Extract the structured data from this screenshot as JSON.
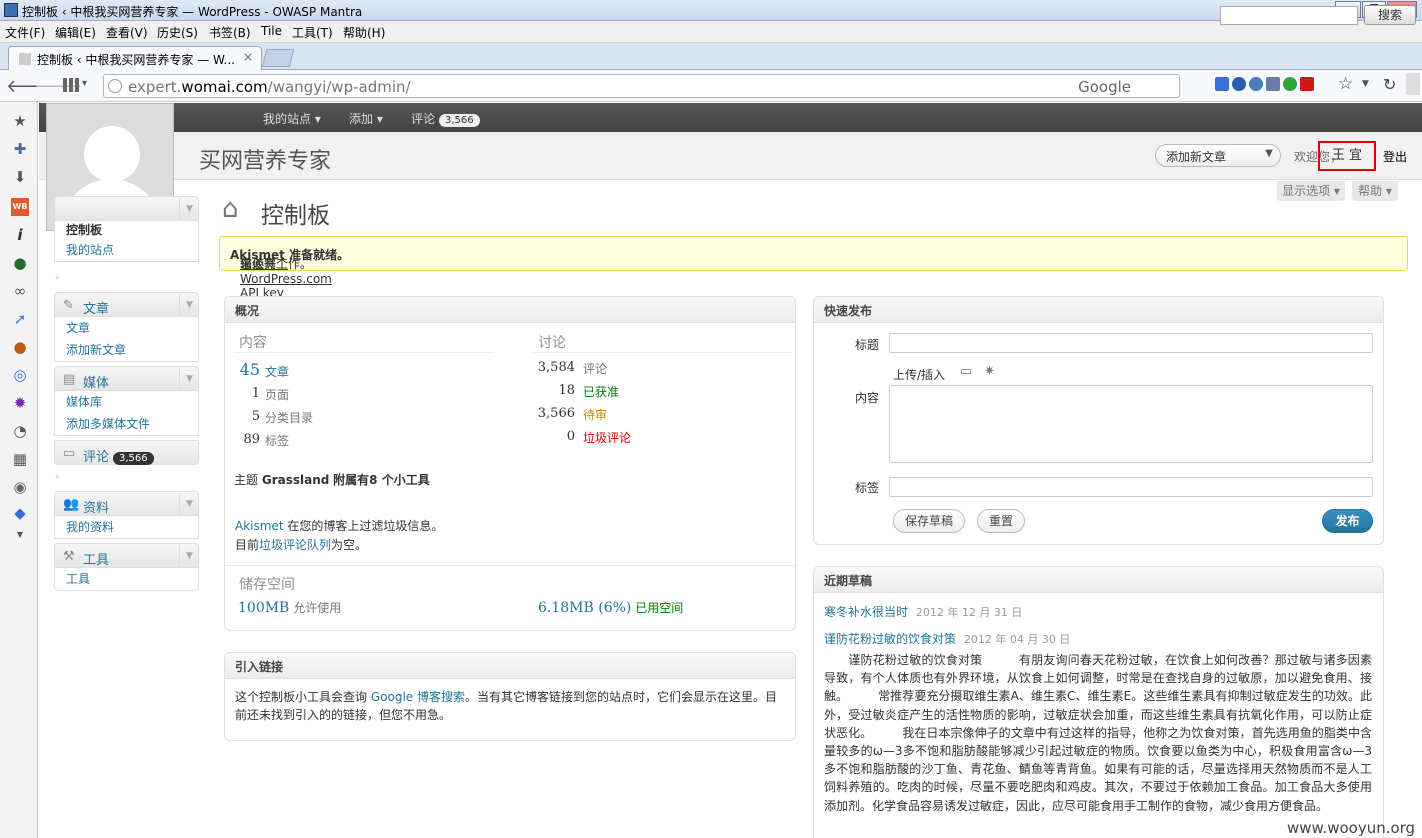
{
  "window": {
    "title": "控制板 ‹ 中根我买网营养专家 — WordPress - OWASP Mantra"
  },
  "menu": [
    "文件(F)",
    "编辑(E)",
    "查看(V)",
    "历史(S)",
    "书签(B)",
    "Tile",
    "工具(T)",
    "帮助(H)"
  ],
  "tab": {
    "title": "控制板 ‹ 中根我买网营养专家 — W...",
    "close": "×"
  },
  "url": {
    "prefix": "expert.",
    "domain": "womai.com",
    "path": "/wangyi/wp-admin/",
    "search_engine": "Google"
  },
  "icons": {
    "back": "back-arrow-icon",
    "forward": "forward-arrow-icon",
    "bookmark": "star-icon",
    "reload": "reload-icon"
  },
  "adminbar": {
    "my_sites": "我的站点",
    "add": "添加",
    "comments": "评论",
    "comments_count": "3,566",
    "search_button": "搜索"
  },
  "header": {
    "site_name": "买网营养专家",
    "new_post": "添加新文章",
    "welcome": "欢迎您，",
    "user": "王 宜",
    "logout": "登出"
  },
  "screen": {
    "options": "显示选项",
    "help": "帮助"
  },
  "sidebar": {
    "dashboard": {
      "items": [
        "控制板",
        "我的站点"
      ]
    },
    "posts": {
      "label": "文章",
      "items": [
        "文章",
        "添加新文章"
      ]
    },
    "media": {
      "label": "媒体",
      "items": [
        "媒体库",
        "添加多媒体文件"
      ]
    },
    "comments": {
      "label": "评论",
      "count": "3,566"
    },
    "profile": {
      "label": "资料",
      "items": [
        "我的资料"
      ]
    },
    "tools": {
      "label": "工具",
      "items": [
        "工具"
      ]
    }
  },
  "page": {
    "title": "控制板"
  },
  "notice": {
    "bold": "Akismet 准备就绪。",
    "pre": "您必需",
    "link": "输入一个 WordPress.com API key",
    "post": "来使其工作。"
  },
  "overview": {
    "title": "概况",
    "content_head": "内容",
    "discussion_head": "讨论",
    "content": [
      {
        "n": "45",
        "l": "文章"
      },
      {
        "n": "1",
        "l": "页面"
      },
      {
        "n": "5",
        "l": "分类目录"
      },
      {
        "n": "89",
        "l": "标签"
      }
    ],
    "discussion": [
      {
        "n": "3,584",
        "l": "评论"
      },
      {
        "n": "18",
        "l": "已获准"
      },
      {
        "n": "3,566",
        "l": "待审"
      },
      {
        "n": "0",
        "l": "垃圾评论"
      }
    ],
    "theme_pre": "主题",
    "theme_name": "Grassland",
    "theme_post": "附属有8 个小工具",
    "akismet_link": "Akismet",
    "akismet_text": "在您的博客上过滤垃圾信息。",
    "queue_pre": "目前",
    "queue_link": "垃圾评论队列",
    "queue_post": "为空。",
    "storage_head": "储存空间",
    "storage_total": "100MB",
    "storage_allowed": "允许使用",
    "storage_used": "6.18MB (6%)",
    "storage_used_label": "已用空间"
  },
  "incoming": {
    "title": "引入链接",
    "pre": "这个控制板小工具会查询",
    "link": "Google 博客搜索",
    "post": "。当有其它博客链接到您的站点时，它们会显示在这里。目前还未找到引入的的链接，但您不用急。"
  },
  "quickpress": {
    "title": "快速发布",
    "title_label": "标题",
    "upload_label": "上传/插入",
    "content_label": "内容",
    "tags_label": "标签",
    "save_draft": "保存草稿",
    "reset": "重置",
    "publish": "发布"
  },
  "drafts": {
    "title": "近期草稿",
    "items": [
      {
        "title": "寒冬补水很当时",
        "date": "2012 年 12 月 31 日"
      },
      {
        "title": "谨防花粉过敏的饮食对策",
        "date": "2012 年 04 月 30 日"
      }
    ],
    "excerpt": "　　谨防花粉过敏的饮食对策　　　有朋友询问春天花粉过敏，在饮食上如何改善？那过敏与诸多因素导致，有个人体质也有外界环境，从饮食上如何调整，时常是在查找自身的过敏原，加以避免食用、接触。　　　常推荐要充分摄取维生素A、维生素C、维生素E。这些维生素具有抑制过敏症发生的功效。此外，受过敏炎症产生的活性物质的影响，过敏症状会加重，而这些维生素具有抗氧化作用，可以防止症状恶化。　　　我在日本宗像伸子的文章中有过这样的指导，他称之为饮食对策，首先选用鱼的脂类中含量较多的ω—3多不饱和脂肪酸能够减少引起过敏症的物质。饮食要以鱼类为中心，积极食用富含ω—3多不饱和脂肪酸的沙丁鱼、青花鱼、鲭鱼等青背鱼。如果有可能的话，尽量选择用天然物质而不是人工饲料养殖的。吃肉的时候，尽量不要吃肥肉和鸡皮。其次，不要过于依赖加工食品。加工食品大多使用添加剂。化学食品容易诱发过敏症，因此，应尽可能食用手工制作的食物，减少食用方便食品。"
  },
  "watermark": "www.wooyun.org"
}
